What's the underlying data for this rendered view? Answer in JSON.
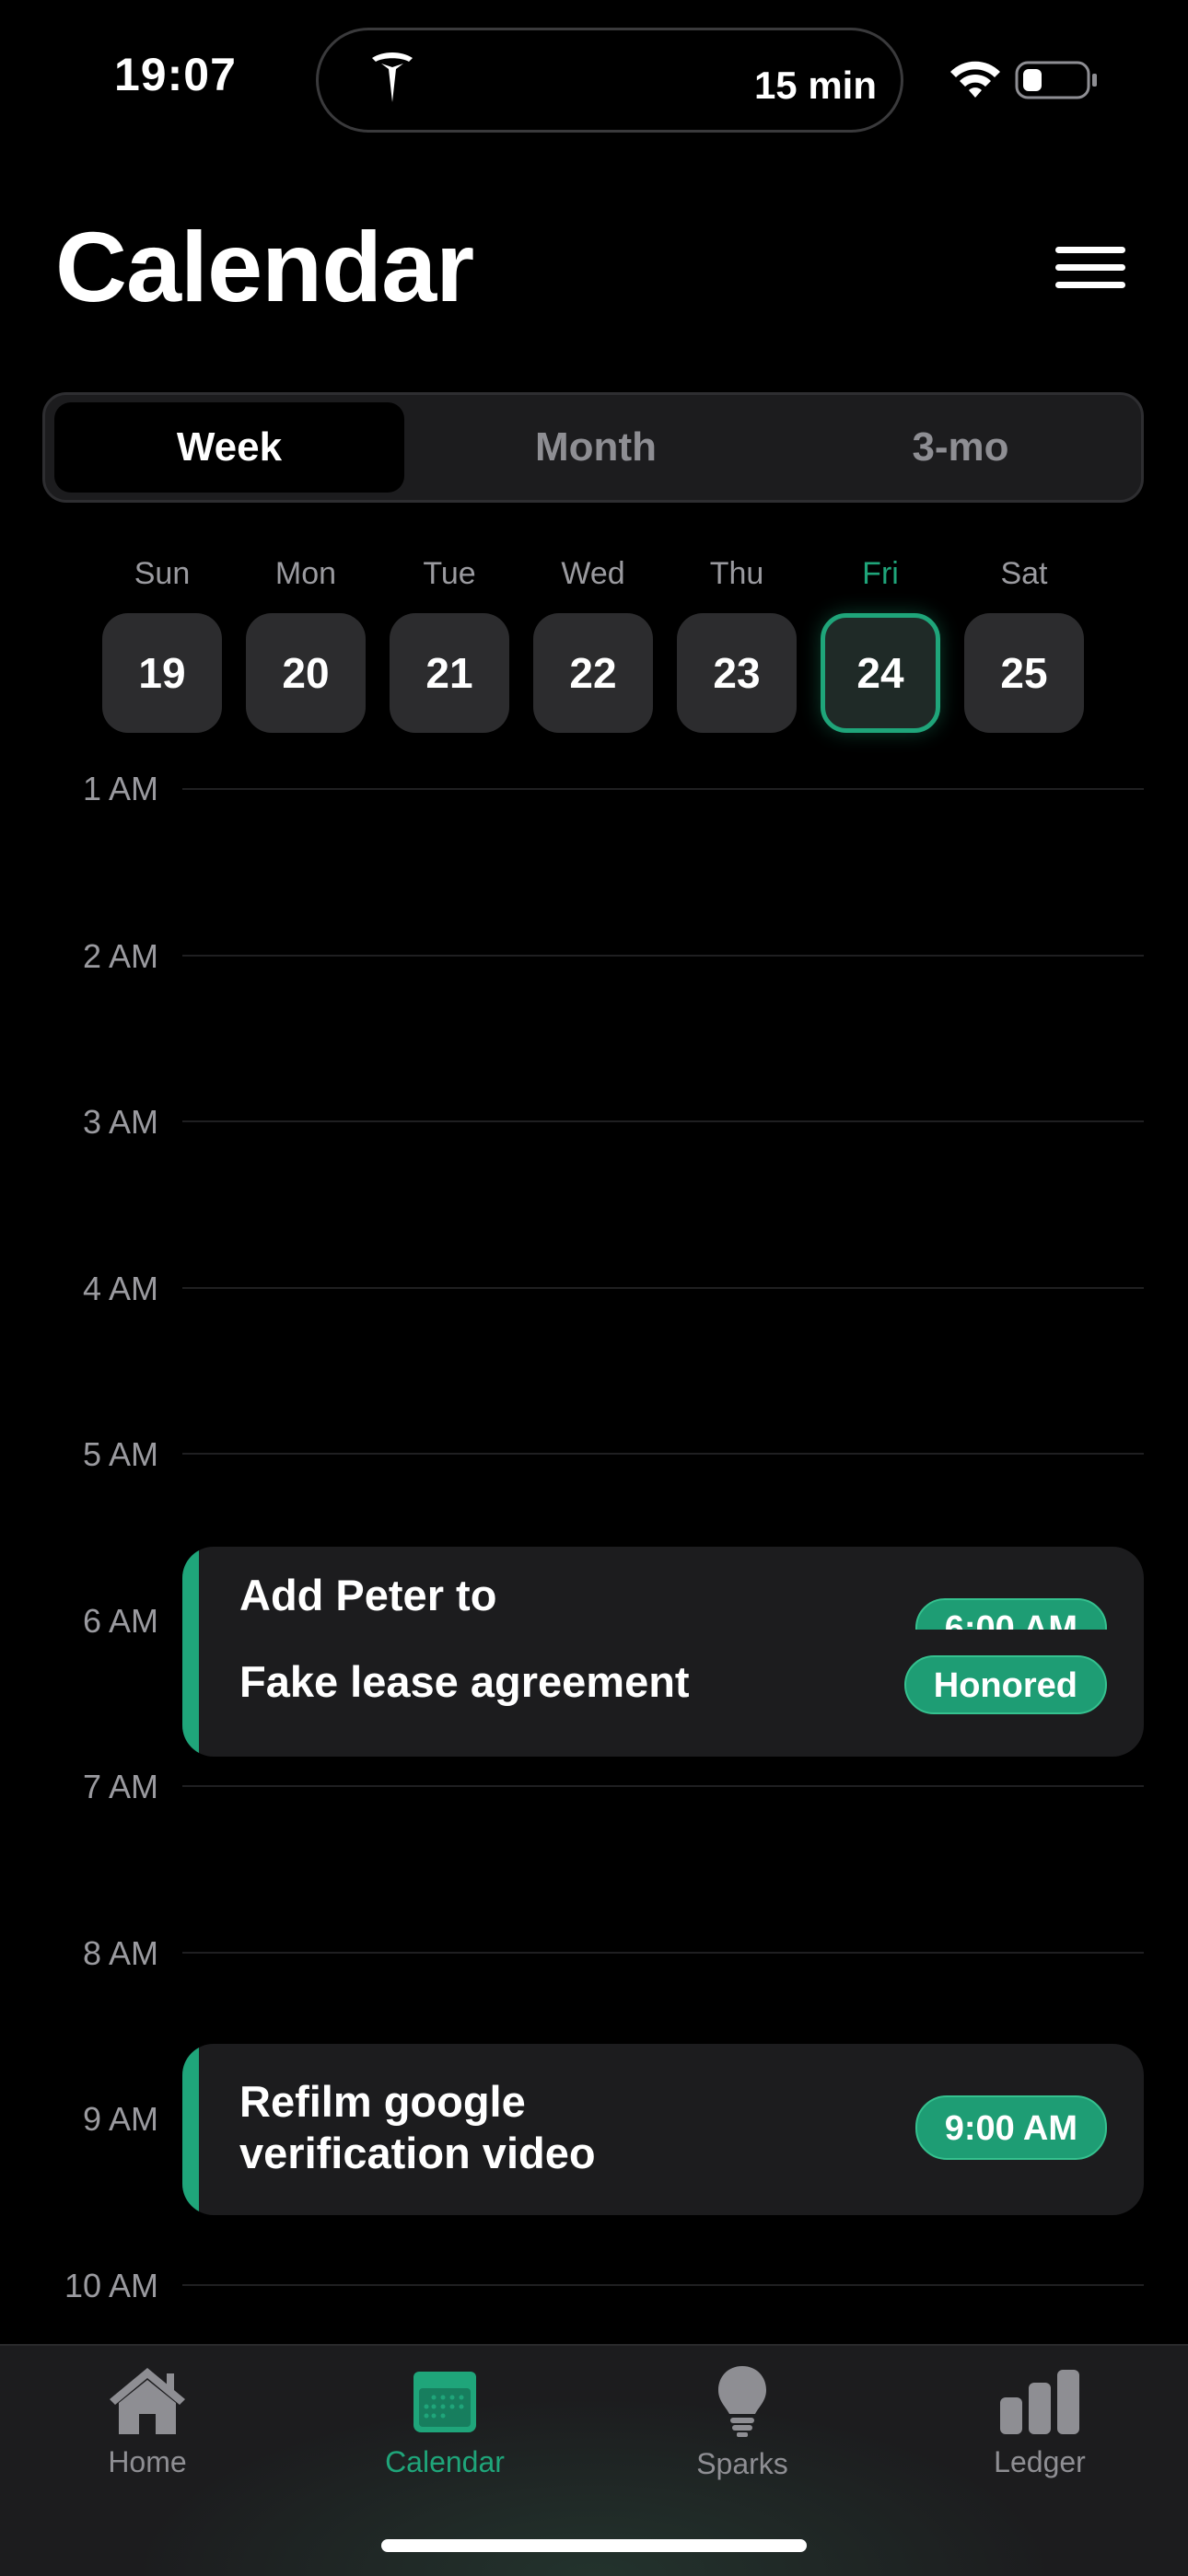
{
  "status_bar": {
    "time": "19:07",
    "activity": "15 min"
  },
  "header": {
    "title": "Calendar"
  },
  "view_tabs": [
    {
      "label": "Week",
      "active": true
    },
    {
      "label": "Month",
      "active": false
    },
    {
      "label": "3-mo",
      "active": false
    }
  ],
  "week": [
    {
      "day": "Sun",
      "date": "19"
    },
    {
      "day": "Mon",
      "date": "20"
    },
    {
      "day": "Tue",
      "date": "21"
    },
    {
      "day": "Wed",
      "date": "22"
    },
    {
      "day": "Thu",
      "date": "23"
    },
    {
      "day": "Fri",
      "date": "24",
      "selected": true
    },
    {
      "day": "Sat",
      "date": "25"
    }
  ],
  "hours": [
    "1 AM",
    "2 AM",
    "3 AM",
    "4 AM",
    "5 AM",
    "6 AM",
    "7 AM",
    "8 AM",
    "9 AM",
    "10 AM"
  ],
  "events": [
    {
      "title": "Add Peter to",
      "time": "6:00 AM"
    },
    {
      "title": "Fake lease agreement",
      "status": "Honored"
    },
    {
      "title_line1": "Refilm google",
      "title_line2": "verification video",
      "time": "9:00 AM"
    }
  ],
  "tab_bar": [
    {
      "label": "Home",
      "icon": "house-icon",
      "active": false
    },
    {
      "label": "Calendar",
      "icon": "calendar-icon",
      "active": true
    },
    {
      "label": "Sparks",
      "icon": "lightbulb-icon",
      "active": false
    },
    {
      "label": "Ledger",
      "icon": "bar-chart-icon",
      "active": false
    }
  ],
  "colors": {
    "accent": "#1fa57a",
    "background": "#000000",
    "card": "#1c1c1e"
  }
}
